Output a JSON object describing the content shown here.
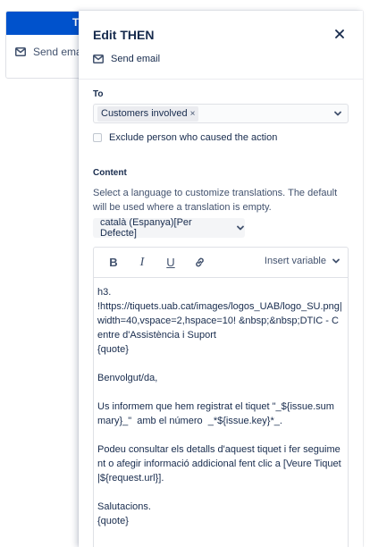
{
  "background_card": {
    "header_letter": "T",
    "action_label": "Send emai"
  },
  "panel": {
    "title": "Edit THEN",
    "action_label": "Send email"
  },
  "to": {
    "label": "To",
    "chip_label": "Customers involved",
    "chip_remove": "×"
  },
  "exclude": {
    "label": "Exclude person who caused the action",
    "checked": false
  },
  "content": {
    "label": "Content",
    "help_text": "Select a language to customize translations. The default will be used where a translation is empty.",
    "language": "català (Espanya)[Per Defecte]"
  },
  "editor": {
    "bold": "B",
    "italic": "I",
    "underline": "U",
    "insert_variable": "Insert variable",
    "body": "h3.\n!https://tiquets.uab.cat/images/logos_UAB/logo_SU.png|width=40,vspace=2,hspace=10! &nbsp;&nbsp;DTIC - Centre d'Assistència i Suport\n{quote}\n\nBenvolgut/da,\n\nUs informem que hem registrat el tiquet \"_${issue.summary}_\"  amb el número  _*${issue.key}*_.\n\nPodeu consultar els detalls d'aquest tiquet i fer seguiment o afegir informació addicional fent clic a [Veure Tiquet|${request.url}].\n\nSalutacions.\n{quote}"
  },
  "icons": {
    "envelope": "envelope-icon",
    "close": "close-icon",
    "chevron": "chevron-down-icon",
    "link": "link-icon"
  },
  "colors": {
    "accent": "#0052cc",
    "text": "#172b4d",
    "subtle": "#42526e",
    "border": "#dfe1e6"
  }
}
